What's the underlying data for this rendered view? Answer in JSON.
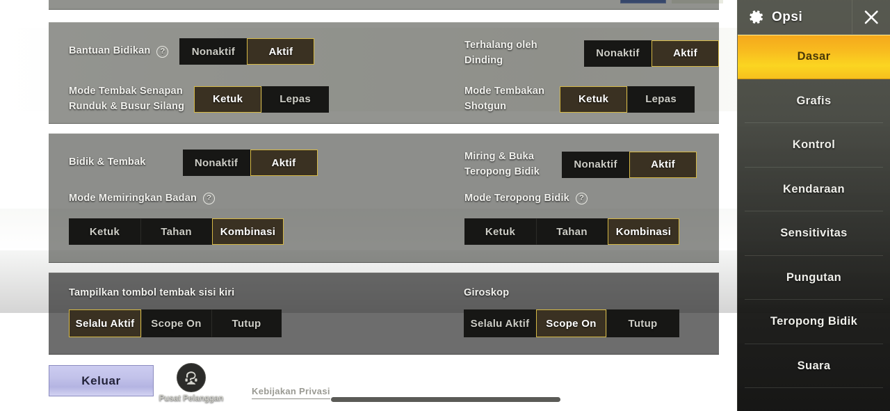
{
  "sidebar": {
    "title": "Opsi",
    "gear_icon": "gear-icon",
    "close_icon": "close-icon",
    "items": [
      {
        "label": "Dasar",
        "active": true
      },
      {
        "label": "Grafis",
        "active": false
      },
      {
        "label": "Kontrol",
        "active": false
      },
      {
        "label": "Kendaraan",
        "active": false
      },
      {
        "label": "Sensitivitas",
        "active": false
      },
      {
        "label": "Pungutan",
        "active": false
      },
      {
        "label": "Teropong Bidik",
        "active": false
      },
      {
        "label": "Suara",
        "active": false
      }
    ],
    "active_accent": "#fbd521"
  },
  "settings": {
    "aim_panel": {
      "aim_assist": {
        "label": "Bantuan Bidikan",
        "help": "?",
        "options": [
          "Nonaktif",
          "Aktif"
        ],
        "selected": "Aktif"
      },
      "rifle_mode": {
        "label": "Mode Tembak Senapan\nRunduk & Busur Silang",
        "options": [
          "Ketuk",
          "Lepas"
        ],
        "selected": "Ketuk"
      },
      "wall_block": {
        "label": "Terhalang oleh Dinding",
        "options": [
          "Nonaktif",
          "Aktif"
        ],
        "selected": "Aktif"
      },
      "shotgun_mode": {
        "label": "Mode Tembakan\nShotgun",
        "options": [
          "Ketuk",
          "Lepas"
        ],
        "selected": "Ketuk"
      }
    },
    "lean_panel": {
      "aim_fire": {
        "label": "Bidik & Tembak",
        "options": [
          "Nonaktif",
          "Aktif"
        ],
        "selected": "Aktif"
      },
      "lean_mode": {
        "label": "Mode Memiringkan Badan",
        "help": "?",
        "options": [
          "Ketuk",
          "Tahan",
          "Kombinasi"
        ],
        "selected": "Kombinasi"
      },
      "peek_scope": {
        "label": "Miring & Buka\n Teropong Bidik",
        "options": [
          "Nonaktif",
          "Aktif"
        ],
        "selected": "Aktif"
      },
      "scope_mode": {
        "label": "Mode Teropong Bidik",
        "help": "?",
        "options": [
          "Ketuk",
          "Tahan",
          "Kombinasi"
        ],
        "selected": "Kombinasi"
      }
    },
    "buttons_panel": {
      "left_fire": {
        "label": "Tampilkan tombol tembak sisi kiri",
        "options": [
          "Selalu Aktif",
          "Scope On",
          "Tutup"
        ],
        "selected": "Selalu Aktif"
      },
      "gyroscope": {
        "label": "Giroskop",
        "options": [
          "Selalu Aktif",
          "Scope On",
          "Tutup"
        ],
        "selected": "Scope On"
      }
    }
  },
  "bottom": {
    "exit_label": "Keluar",
    "customer_service_label": "Pusat Pelanggan",
    "customer_service_icon": "headset-support-icon",
    "privacy_label": "Kebijakan Privasi"
  }
}
